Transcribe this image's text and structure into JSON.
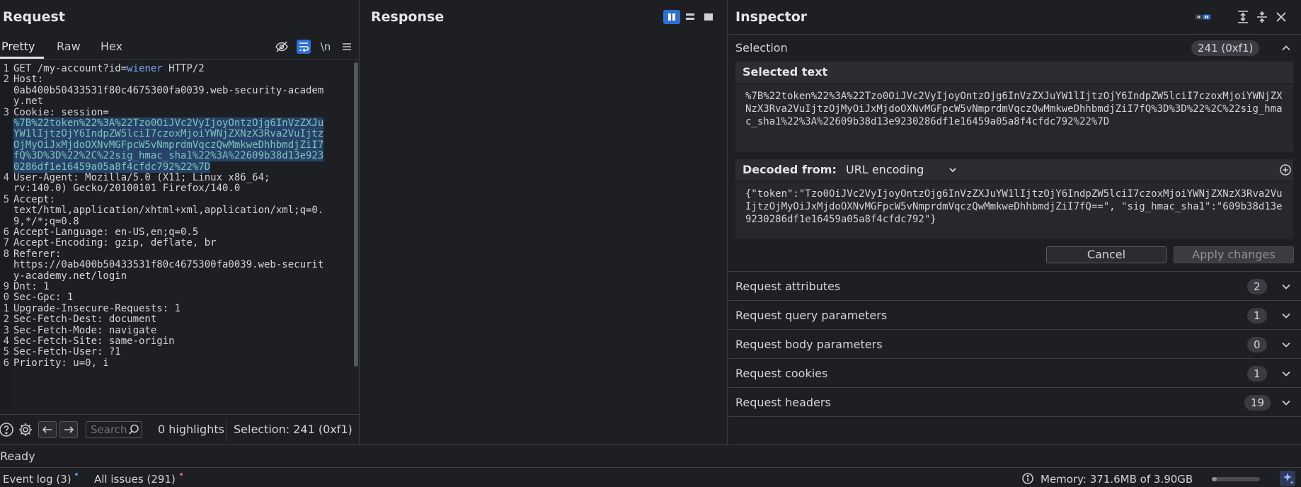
{
  "request": {
    "title": "Request",
    "tabs": [
      "Pretty",
      "Raw",
      "Hex"
    ],
    "line_numbers": [
      "1",
      "2",
      "",
      "",
      "3",
      "",
      "",
      "",
      "",
      "",
      "",
      "4",
      "",
      "5",
      "",
      "",
      "6",
      "7",
      "8",
      "",
      "",
      "9",
      "0",
      "1",
      "2",
      "3",
      "4",
      "5",
      "6"
    ],
    "lines": [
      {
        "n": "1",
        "t": "GET /my-account?id=",
        "blue": "wiener",
        "t2": " HTTP/2"
      },
      {
        "n": "2",
        "t": "Host:"
      },
      {
        "n": "",
        "t": "0ab400b50433531f80c4675300fa0039.web-security-academ"
      },
      {
        "n": "",
        "t": "y.net"
      },
      {
        "n": "3",
        "t": "Cookie: session="
      },
      {
        "n": "",
        "sel": "%7B%22token%22%3A%22Tzo0OiJVc2VyIjoyOntzOjg6InVzZXJu"
      },
      {
        "n": "",
        "sel": "YW1lIjtzOjY6IndpZW5lciI7czoxMjoiYWNjZXNzX3Rva2VuIjtz"
      },
      {
        "n": "",
        "sel": "OjMyOiJxMjdoOXNvMGFpcW5vNmprdmVqczQwMmkweDhhbmdjZiI7"
      },
      {
        "n": "",
        "sel": "fQ%3D%3D%22%2C%22sig_hmac_sha1%22%3A%22609b38d13e923"
      },
      {
        "n": "",
        "sel": "0286df1e16459a05a8f4cfdc792%22%7D"
      },
      {
        "n": "4",
        "t": "User-Agent: Mozilla/5.0 (X11; Linux x86_64;"
      },
      {
        "n": "",
        "t": "rv:140.0) Gecko/20100101 Firefox/140.0"
      },
      {
        "n": "5",
        "t": "Accept:"
      },
      {
        "n": "",
        "t": "text/html,application/xhtml+xml,application/xml;q=0."
      },
      {
        "n": "",
        "t": "9,*/*;q=0.8"
      },
      {
        "n": "6",
        "t": "Accept-Language: en-US,en;q=0.5"
      },
      {
        "n": "7",
        "t": "Accept-Encoding: gzip, deflate, br"
      },
      {
        "n": "8",
        "t": "Referer:"
      },
      {
        "n": "",
        "t": "https://0ab400b50433531f80c4675300fa0039.web-securit"
      },
      {
        "n": "",
        "t": "y-academy.net/login"
      },
      {
        "n": "9",
        "t": "Dnt: 1"
      },
      {
        "n": "0",
        "t": "Sec-Gpc: 1"
      },
      {
        "n": "1",
        "t": "Upgrade-Insecure-Requests: 1"
      },
      {
        "n": "2",
        "t": "Sec-Fetch-Dest: document"
      },
      {
        "n": "3",
        "t": "Sec-Fetch-Mode: navigate"
      },
      {
        "n": "4",
        "t": "Sec-Fetch-Site: same-origin"
      },
      {
        "n": "5",
        "t": "Sec-Fetch-User: ?1"
      },
      {
        "n": "6",
        "t": "Priority: u=0, i"
      }
    ],
    "search_placeholder": "Search",
    "highlights": "0 highlights",
    "selection": "Selection: 241 (0xf1)"
  },
  "response": {
    "title": "Response"
  },
  "inspector": {
    "title": "Inspector",
    "selection_label": "Selection",
    "selection_count": "241 (0xf1)",
    "selected_text_label": "Selected text",
    "selected_text": "%7B%22token%22%3A%22Tzo0OiJVc2VyIjoyOntzOjg6InVzZXJuYW1lIjtzOjY6IndpZW5lciI7czoxMjoiYWNjZXNzX3Rva2VuIjtzOjMyOiJxMjdoOXNvMGFpcW5vNmprdmVqczQwMmkweDhhbmdjZiI7fQ%3D%3D%22%2C%22sig_hmac_sha1%22%3A%22609b38d13e9230286df1e16459a05a8f4cfdc792%22%7D",
    "decoded_from_label": "Decoded from:",
    "decoded_from_value": "URL encoding",
    "decoded_text": "{\"token\":\"Tzo0OiJVc2VyIjoyOntzOjg6InVzZXJuYW1lIjtzOjY6IndpZW5lciI7czoxMjoiYWNjZXNzX3Rva2VuIjtzOjMyOiJxMjdoOXNvMGFpcW5vNmprdmVqczQwMmkweDhhbmdjZiI7fQ==\", \"sig_hmac_sha1\":\"609b38d13e9230286df1e16459a05a8f4cfdc792\"}",
    "cancel_label": "Cancel",
    "apply_label": "Apply changes",
    "sections": [
      {
        "label": "Request attributes",
        "count": "2"
      },
      {
        "label": "Request query parameters",
        "count": "1"
      },
      {
        "label": "Request body parameters",
        "count": "0"
      },
      {
        "label": "Request cookies",
        "count": "1"
      },
      {
        "label": "Request headers",
        "count": "19"
      }
    ]
  },
  "status": "Ready",
  "footer": {
    "event_log": "Event log (3)",
    "all_issues": "All issues (291)",
    "memory": "Memory: 371.6MB of 3.90GB",
    "memory_fraction": 0.1
  },
  "colors": {
    "accent": "#2f6ed3",
    "selection_text": "#79c4b8",
    "selection_bg": "#27436a",
    "param_value": "#6fa8ff",
    "event_dot": "#4a90e2",
    "issues_dot": "#e8507a"
  }
}
